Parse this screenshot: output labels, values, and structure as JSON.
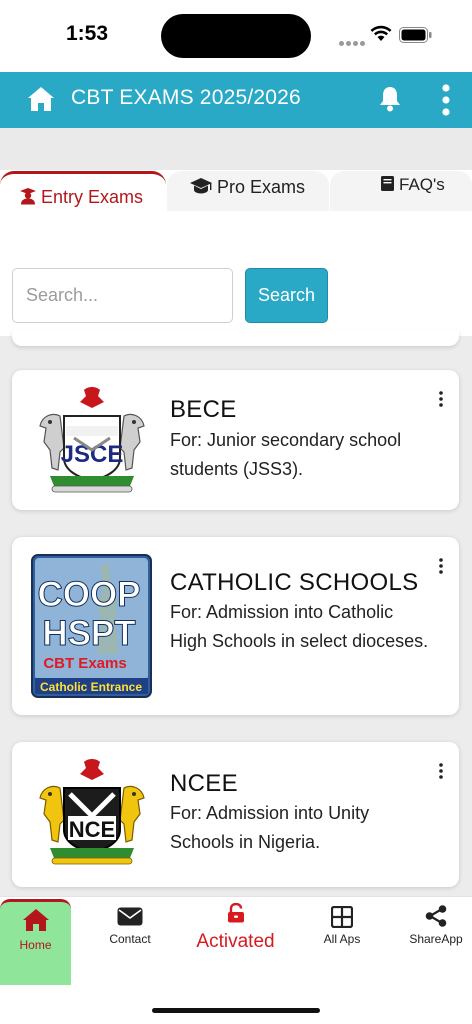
{
  "status_bar": {
    "time": "1:53"
  },
  "header": {
    "title": "CBT EXAMS 2025/2026",
    "color": "#29a9c6"
  },
  "tabs": [
    {
      "label": "Entry Exams",
      "icon": "graduation-cap-user-icon",
      "active": true
    },
    {
      "label": "Pro Exams",
      "icon": "graduation-cap-icon",
      "active": false
    },
    {
      "label": "FAQ's",
      "icon": "book-icon",
      "active": false
    }
  ],
  "search": {
    "placeholder": "Search...",
    "value": "",
    "button_label": "Search"
  },
  "exams": [
    {
      "title": "BECE",
      "description": "For: Junior secondary school students (JSS3).",
      "logo": "jsce-coat-of-arms-logo",
      "logo_text": "JSCE"
    },
    {
      "title": "CATHOLIC SCHOOLS",
      "description": "For: Admission into Catholic High Schools in select dioceses.",
      "logo": "coop-hspt-logo",
      "logo_text": [
        "COOP",
        "HSPT",
        "CBT Exams",
        "Catholic Entrance"
      ]
    },
    {
      "title": "NCEE",
      "description": "For: Admission into Unity Schools in Nigeria.",
      "logo": "nce-coat-of-arms-logo",
      "logo_text": "NCE"
    }
  ],
  "bottom_nav": [
    {
      "label": "Home",
      "icon": "home-icon",
      "active": true
    },
    {
      "label": "Contact",
      "icon": "envelope-icon"
    },
    {
      "label": "Activated",
      "icon": "unlock-icon"
    },
    {
      "label": "All Aps",
      "icon": "grid-icon"
    },
    {
      "label": "ShareApp",
      "icon": "share-icon"
    }
  ],
  "colors": {
    "accent": "#29a9c6",
    "active_tab": "#b3171b",
    "activated": "#d71920",
    "home_highlight": "#8fe59a"
  }
}
